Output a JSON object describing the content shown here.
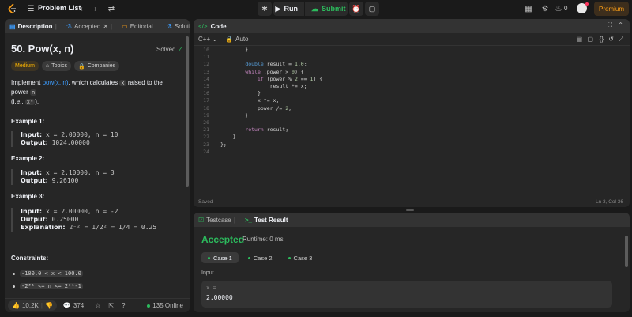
{
  "topbar": {
    "problem_list": "Problem List",
    "run": "Run",
    "submit": "Submit",
    "streak": "0",
    "premium": "Premium"
  },
  "tabs": {
    "description": "Description",
    "accepted": "Accepted",
    "editorial": "Editorial",
    "solutions": "Solutions"
  },
  "problem": {
    "title": "50. Pow(x, n)",
    "status": "Solved",
    "difficulty": "Medium",
    "topics": "Topics",
    "companies": "Companies",
    "intro_pre": "Implement ",
    "intro_link": "pow(x, n)",
    "intro_mid": ", which calculates ",
    "intro_x": "x",
    "intro_post": " raised to the power ",
    "intro_n": "n",
    "intro_ie": "(i.e., ",
    "intro_xn": "xⁿ",
    "intro_end": ")."
  },
  "examples": [
    {
      "title": "Example 1:",
      "input_label": "Input:",
      "input": "x = 2.00000, n = 10",
      "output_label": "Output:",
      "output": "1024.00000"
    },
    {
      "title": "Example 2:",
      "input_label": "Input:",
      "input": "x = 2.10000, n = 3",
      "output_label": "Output:",
      "output": "9.26100"
    },
    {
      "title": "Example 3:",
      "input_label": "Input:",
      "input": "x = 2.00000, n = -2",
      "output_label": "Output:",
      "output": "0.25000",
      "explanation_label": "Explanation:",
      "explanation": "2⁻² = 1/2² = 1/4 = 0.25"
    }
  ],
  "constraints": {
    "title": "Constraints:",
    "items": [
      "-100.0 < x < 100.0",
      "-2³¹ <= n <= 2³¹-1"
    ]
  },
  "footer": {
    "likes": "10.2K",
    "comments": "374",
    "online": "135 Online"
  },
  "code": {
    "header": "Code",
    "language": "C++",
    "mode": "Auto",
    "status": "Saved",
    "cursor": "Ln 3, Col 36",
    "lines": [
      {
        "n": "10",
        "t": "        }"
      },
      {
        "n": "11",
        "t": ""
      },
      {
        "n": "12",
        "t": "        double result = 1.0;"
      },
      {
        "n": "13",
        "t": "        while (power > 0) {"
      },
      {
        "n": "14",
        "t": "            if (power % 2 == 1) {"
      },
      {
        "n": "15",
        "t": "                result *= x;"
      },
      {
        "n": "16",
        "t": "            }"
      },
      {
        "n": "17",
        "t": "            x *= x;"
      },
      {
        "n": "18",
        "t": "            power /= 2;"
      },
      {
        "n": "19",
        "t": "        }"
      },
      {
        "n": "20",
        "t": ""
      },
      {
        "n": "21",
        "t": "        return result;"
      },
      {
        "n": "22",
        "t": "    }"
      },
      {
        "n": "23",
        "t": "};"
      },
      {
        "n": "24",
        "t": ""
      }
    ]
  },
  "result": {
    "testcase_tab": "Testcase",
    "result_tab": "Test Result",
    "verdict": "Accepted",
    "runtime": "Runtime: 0 ms",
    "cases": [
      "Case 1",
      "Case 2",
      "Case 3"
    ],
    "input_label": "Input",
    "var_name": "x =",
    "var_value": "2.00000"
  },
  "colors": {
    "accent_green": "#2cbb5d",
    "premium_orange": "#ffa116",
    "link_blue": "#3c9cfd",
    "medium_yellow": "#ffb800"
  }
}
